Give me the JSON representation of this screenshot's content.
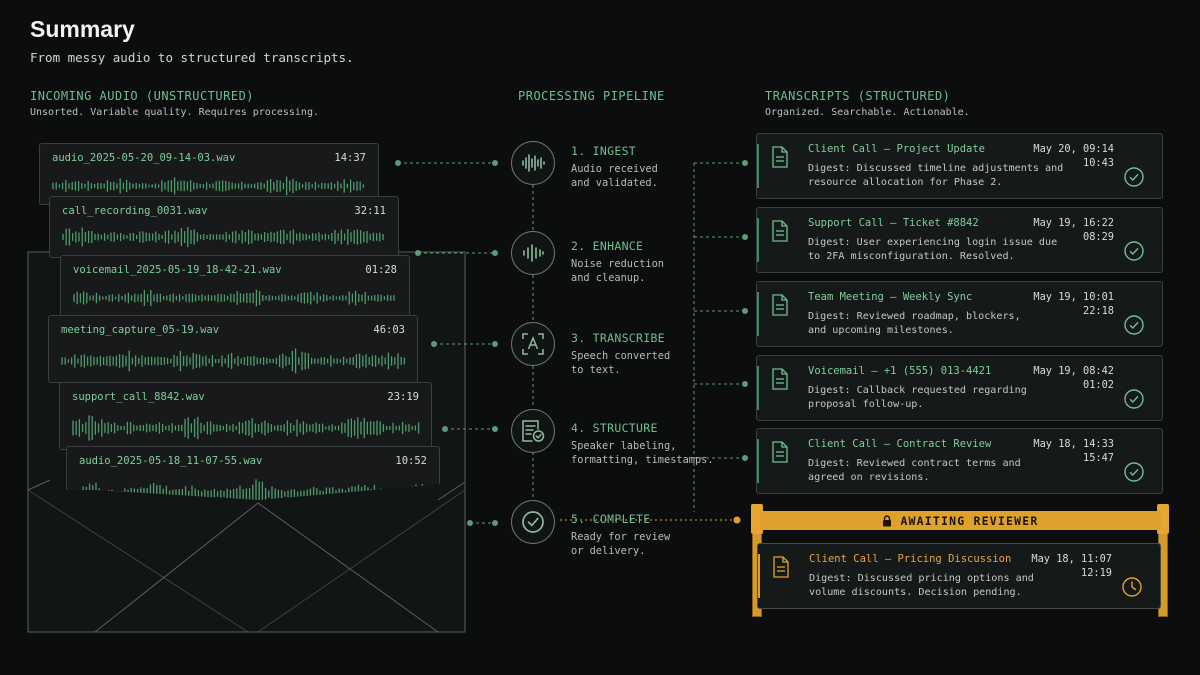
{
  "header": {
    "title": "Summary",
    "subtitle": "From messy audio to structured transcripts."
  },
  "incoming": {
    "heading": "INCOMING AUDIO (UNSTRUCTURED)",
    "subheading": "Unsorted. Variable quality. Requires processing.",
    "files": [
      {
        "name": "audio_2025-05-20_09-14-03.wav",
        "duration": "14:37"
      },
      {
        "name": "call_recording_0031.wav",
        "duration": "32:11"
      },
      {
        "name": "voicemail_2025-05-19_18-42-21.wav",
        "duration": "01:28"
      },
      {
        "name": "meeting_capture_05-19.wav",
        "duration": "46:03"
      },
      {
        "name": "support_call_8842.wav",
        "duration": "23:19"
      },
      {
        "name": "audio_2025-05-18_11-07-55.wav",
        "duration": "10:52"
      }
    ]
  },
  "pipeline": {
    "heading": "PROCESSING PIPELINE",
    "steps": [
      {
        "title": "1. INGEST",
        "desc": "Audio received\nand validated.",
        "icon": "waveform-icon"
      },
      {
        "title": "2. ENHANCE",
        "desc": "Noise reduction\nand cleanup.",
        "icon": "waveform-icon"
      },
      {
        "title": "3. TRANSCRIBE",
        "desc": "Speech converted\nto text.",
        "icon": "text-scan-icon"
      },
      {
        "title": "4. STRUCTURE",
        "desc": "Speaker labeling,\nformatting, timestamps.",
        "icon": "list-check-icon"
      },
      {
        "title": "5. COMPLETE",
        "desc": "Ready for review\nor delivery.",
        "icon": "check-circle-icon"
      }
    ]
  },
  "transcripts": {
    "heading": "TRANSCRIPTS (STRUCTURED)",
    "subheading": "Organized. Searchable. Actionable.",
    "items": [
      {
        "title": "Client Call – Project Update",
        "date": "May 20, 09:14",
        "time": "10:43",
        "digest": "Digest: Discussed timeline adjustments and\nresource allocation for Phase 2.",
        "status": "check-circle-icon"
      },
      {
        "title": "Support Call – Ticket #8842",
        "date": "May 19, 16:22",
        "time": "08:29",
        "digest": "Digest: User experiencing login issue due\nto 2FA misconfiguration. Resolved.",
        "status": "check-circle-icon"
      },
      {
        "title": "Team Meeting – Weekly Sync",
        "date": "May 19, 10:01",
        "time": "22:18",
        "digest": "Digest: Reviewed roadmap, blockers,\nand upcoming milestones.",
        "status": "check-circle-icon"
      },
      {
        "title": "Voicemail – +1 (555) 013-4421",
        "date": "May 19, 08:42",
        "time": "01:02",
        "digest": "Digest: Callback requested regarding\nproposal follow-up.",
        "status": "check-circle-icon"
      },
      {
        "title": "Client Call – Contract Review",
        "date": "May 18, 14:33",
        "time": "15:47",
        "digest": "Digest: Reviewed contract terms and\nagreed on revisions.",
        "status": "check-circle-icon"
      }
    ],
    "gate_label": "AWAITING REVIEWER",
    "pending": {
      "title": "Client Call – Pricing Discussion",
      "date": "May 18, 11:07",
      "time": "12:19",
      "digest": "Digest: Discussed pricing options and\nvolume discounts. Decision pending.",
      "status": "clock-icon"
    }
  },
  "colors": {
    "accent_green": "#6fbf8e",
    "accent_amber": "#e0a12c",
    "background": "#0b0d0e"
  }
}
